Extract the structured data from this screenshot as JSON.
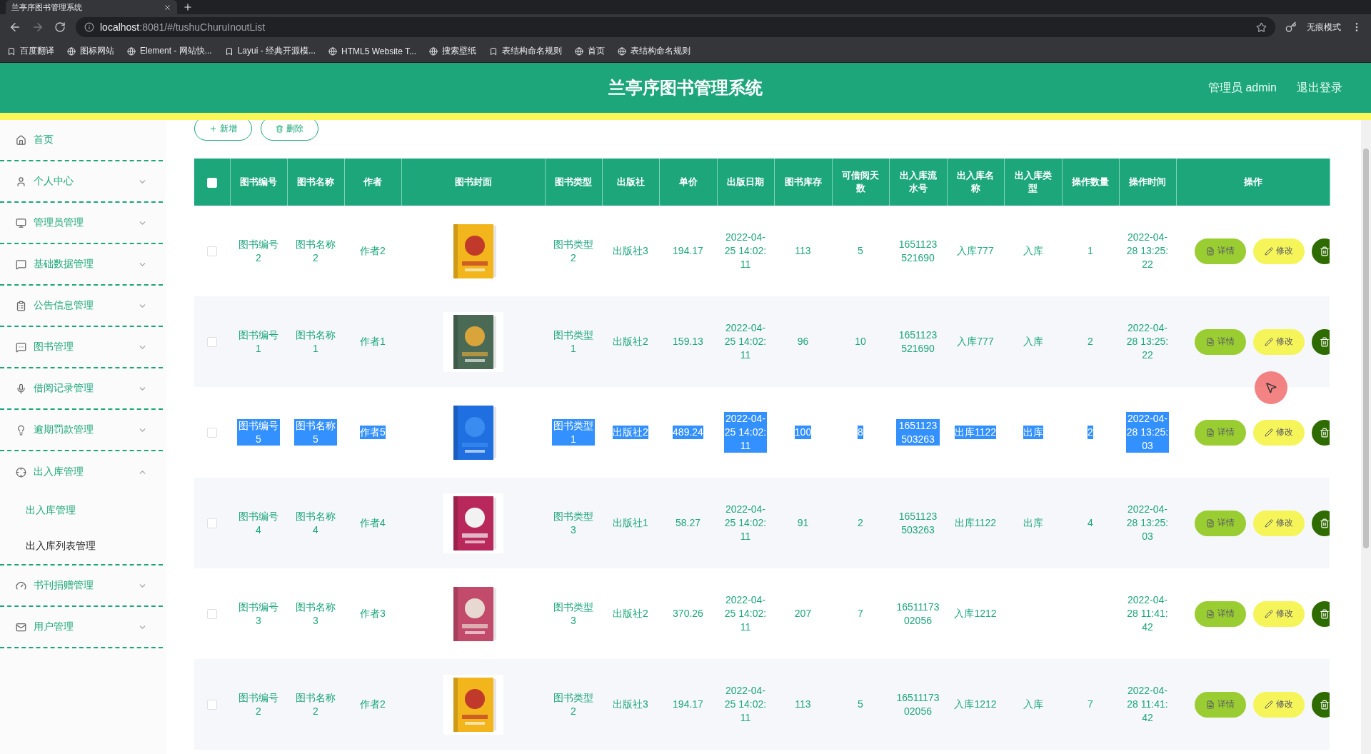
{
  "browser": {
    "tab_title": "兰亭序图书管理系统",
    "url_host": "localhost",
    "url_path": ":8081/#/tushuChuruInoutList",
    "incognito_label": "无痕模式",
    "bookmarks": [
      "百度翻译",
      "图标网站",
      "Element - 网站快...",
      "Layui - 经典开源模...",
      "HTML5 Website T...",
      "搜索壁纸",
      "表结构命名规则",
      "首页",
      "表结构命名规则"
    ]
  },
  "header": {
    "title": "兰亭序图书管理系统",
    "user": "管理员 admin",
    "logout": "退出登录"
  },
  "sidebar": {
    "items": [
      {
        "label": "首页",
        "kind": "link"
      },
      {
        "label": "个人中心",
        "kind": "submenu",
        "expanded": false
      },
      {
        "label": "管理员管理",
        "kind": "submenu",
        "expanded": false
      },
      {
        "label": "基础数据管理",
        "kind": "submenu",
        "expanded": false
      },
      {
        "label": "公告信息管理",
        "kind": "submenu",
        "expanded": false
      },
      {
        "label": "图书管理",
        "kind": "submenu",
        "expanded": false
      },
      {
        "label": "借阅记录管理",
        "kind": "submenu",
        "expanded": false
      },
      {
        "label": "逾期罚款管理",
        "kind": "submenu",
        "expanded": false
      },
      {
        "label": "出入库管理",
        "kind": "submenu",
        "expanded": true,
        "children": [
          {
            "label": "出入库管理",
            "selected": true
          },
          {
            "label": "出入库列表管理",
            "selected": false
          }
        ]
      },
      {
        "label": "书刊捐赠管理",
        "kind": "submenu",
        "expanded": false
      },
      {
        "label": "用户管理",
        "kind": "submenu",
        "expanded": false
      }
    ]
  },
  "toolbar": {
    "buttons": [
      "新增",
      "删除"
    ]
  },
  "table": {
    "all_checked": false,
    "columns": [
      {
        "label": "图书编号",
        "kind": "text"
      },
      {
        "label": "图书名称",
        "kind": "text"
      },
      {
        "label": "作者",
        "kind": "text"
      },
      {
        "label": "图书封面",
        "kind": "picture"
      },
      {
        "label": "图书类型",
        "kind": "text"
      },
      {
        "label": "出版社",
        "kind": "text"
      },
      {
        "label": "单价",
        "kind": "text"
      },
      {
        "label": "出版日期",
        "kind": "text"
      },
      {
        "label": "图书库存",
        "kind": "text"
      },
      {
        "label": "可借阅天数",
        "kind": "text"
      },
      {
        "label": "出入库流水号",
        "kind": "text"
      },
      {
        "label": "出入库名称",
        "kind": "text"
      },
      {
        "label": "出入库类型",
        "kind": "text"
      },
      {
        "label": "操作数量",
        "kind": "text"
      },
      {
        "label": "操作时间",
        "kind": "text"
      },
      {
        "label": "操作",
        "kind": "actions"
      }
    ],
    "rows": [
      {
        "checked": false,
        "text_selected": false,
        "cells": [
          "图书编号2",
          "图书名称2",
          "作者2",
          {
            "kind": "picture"
          },
          "图书类型2",
          "出版社3",
          "194.17",
          "2022-04-25 14:02:11",
          "113",
          "5",
          "1651123521690",
          "入库777",
          "入库",
          "1",
          "2022-04-28 13:25:22"
        ],
        "actions": [
          "详情",
          "修改"
        ]
      },
      {
        "checked": false,
        "text_selected": false,
        "cells": [
          "图书编号1",
          "图书名称1",
          "作者1",
          {
            "kind": "picture"
          },
          "图书类型1",
          "出版社2",
          "159.13",
          "2022-04-25 14:02:11",
          "96",
          "10",
          "1651123521690",
          "入库777",
          "入库",
          "2",
          "2022-04-28 13:25:22"
        ],
        "actions": [
          "详情",
          "修改"
        ]
      },
      {
        "checked": false,
        "text_selected": true,
        "cells": [
          "图书编号5",
          "图书名称5",
          "作者5",
          {
            "kind": "picture"
          },
          "图书类型1",
          "出版社2",
          "489.24",
          "2022-04-25 14:02:11",
          "100",
          "8",
          "1651123503263",
          "出库1122",
          "出库",
          "2",
          "2022-04-28 13:25:03"
        ],
        "actions": [
          "详情",
          "修改"
        ]
      },
      {
        "checked": false,
        "text_selected": false,
        "cells": [
          "图书编号4",
          "图书名称4",
          "作者4",
          {
            "kind": "picture"
          },
          "图书类型3",
          "出版社1",
          "58.27",
          "2022-04-25 14:02:11",
          "91",
          "2",
          "1651123503263",
          "出库1122",
          "出库",
          "4",
          "2022-04-28 13:25:03"
        ],
        "actions": [
          "详情",
          "修改"
        ]
      },
      {
        "checked": false,
        "text_selected": false,
        "cells": [
          "图书编号3",
          "图书名称3",
          "作者3",
          {
            "kind": "picture"
          },
          "图书类型3",
          "出版社2",
          "370.26",
          "2022-04-25 14:02:11",
          "207",
          "7",
          "1651117302056",
          "入库1212",
          "",
          "",
          "2022-04-28 11:41:42"
        ],
        "actions": [
          "详情",
          "修改"
        ]
      },
      {
        "checked": false,
        "text_selected": false,
        "cells": [
          "图书编号2",
          "图书名称2",
          "作者2",
          {
            "kind": "picture"
          },
          "图书类型2",
          "出版社3",
          "194.17",
          "2022-04-25 14:02:11",
          "113",
          "5",
          "1651117302056",
          "入库1212",
          "入库",
          "7",
          "2022-04-28 11:41:42"
        ],
        "actions": [
          "详情",
          "修改"
        ]
      }
    ]
  }
}
